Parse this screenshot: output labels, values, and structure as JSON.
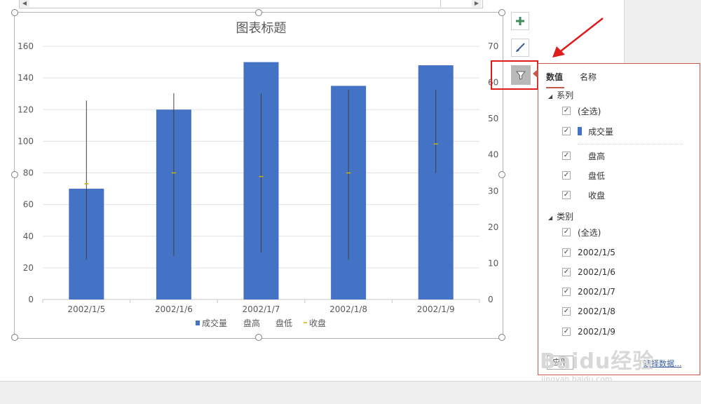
{
  "chart_data": {
    "type": "bar",
    "title": "图表标题",
    "categories": [
      "2002/1/5",
      "2002/1/6",
      "2002/1/7",
      "2002/1/8",
      "2002/1/9"
    ],
    "series": [
      {
        "name": "成交量",
        "values": [
          70,
          120,
          150,
          135,
          148
        ],
        "axis": "left",
        "color": "#4472c4"
      },
      {
        "name": "盘高",
        "values": [
          55,
          57,
          57,
          58,
          58
        ],
        "axis": "right"
      },
      {
        "name": "盘低",
        "values": [
          11,
          12,
          13,
          11,
          35
        ],
        "axis": "right"
      },
      {
        "name": "收盘",
        "values": [
          32,
          35,
          34,
          35,
          43
        ],
        "axis": "right",
        "color": "#c9b800"
      }
    ],
    "left_ticks": [
      "0",
      "20",
      "40",
      "60",
      "80",
      "100",
      "120",
      "140",
      "160"
    ],
    "right_ticks": [
      "0",
      "10",
      "20",
      "30",
      "40",
      "50",
      "60",
      "70"
    ],
    "ylim_left": [
      0,
      160
    ],
    "ylim_right": [
      0,
      70
    ],
    "grid": true,
    "legend_position": "bottom"
  },
  "scroll": {
    "left_arrow": "◀",
    "right_arrow": "▶"
  },
  "side_buttons": {
    "add": "add-chart-element",
    "style": "chart-styles",
    "filter": "chart-filters"
  },
  "filter_panel": {
    "tabs": [
      "数值",
      "名称"
    ],
    "active_tab": "数值",
    "series_header": "系列",
    "series_items": [
      {
        "label": "(全选)",
        "checked": true
      },
      {
        "label": "成交量",
        "checked": true,
        "swatch": "#4472c4"
      },
      {
        "label": "盘高",
        "checked": true
      },
      {
        "label": "盘低",
        "checked": true
      },
      {
        "label": "收盘",
        "checked": true
      }
    ],
    "category_header": "类别",
    "category_items": [
      {
        "label": "(全选)",
        "checked": true
      },
      {
        "label": "2002/1/5",
        "checked": true
      },
      {
        "label": "2002/1/6",
        "checked": true
      },
      {
        "label": "2002/1/7",
        "checked": true
      },
      {
        "label": "2002/1/8",
        "checked": true
      },
      {
        "label": "2002/1/9",
        "checked": true
      }
    ],
    "apply_button": "应用",
    "select_data_link": "选择数据..."
  },
  "watermark": {
    "main": "Baidu经验",
    "sub": "jingyan.baidu.com"
  },
  "annotation_color": "#e01b1b"
}
